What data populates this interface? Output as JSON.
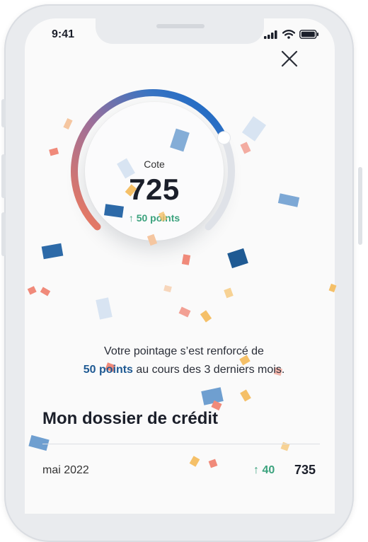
{
  "status_bar": {
    "time": "9:41"
  },
  "icons": {
    "close": "close-icon",
    "signal": "signal-icon",
    "wifi": "wifi-icon",
    "battery": "battery-icon",
    "delta": "arrow-up-icon"
  },
  "gauge": {
    "label": "Cote",
    "score": "725",
    "delta_text": "↑ 50 points",
    "fill_fraction": 0.74
  },
  "message": {
    "line1": "Votre pointage s’est renforcé de",
    "highlight": "50 points",
    "line2_rest": " au cours des 3 derniers mois."
  },
  "section": {
    "title": "Mon dossier de crédit"
  },
  "history": [
    {
      "month": "mai 2022",
      "delta": "↑ 40",
      "score": "735"
    }
  ],
  "colors": {
    "accent_blue": "#1f5a93",
    "positive_green": "#3ba27d",
    "gauge_start": "#f07a5c",
    "gauge_end": "#1266c7"
  }
}
